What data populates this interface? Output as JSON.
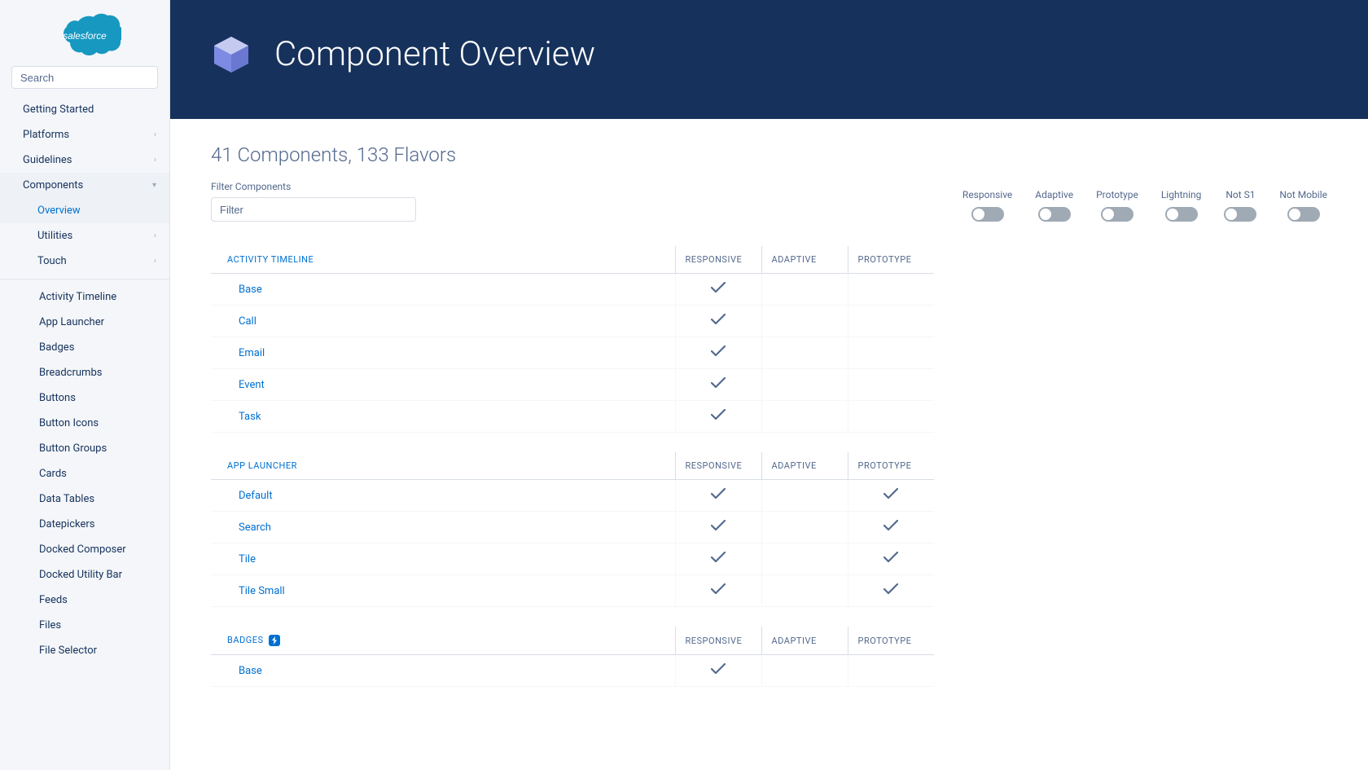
{
  "sidebar": {
    "search_placeholder": "Search",
    "top_nav": [
      {
        "label": "Getting Started",
        "expandable": false
      },
      {
        "label": "Platforms",
        "expandable": true
      },
      {
        "label": "Guidelines",
        "expandable": true
      },
      {
        "label": "Components",
        "expandable": true,
        "open": true
      }
    ],
    "components_sub": [
      {
        "label": "Overview",
        "selected": true,
        "expandable": false
      },
      {
        "label": "Utilities",
        "expandable": true
      },
      {
        "label": "Touch",
        "expandable": true
      }
    ],
    "component_list": [
      "Activity Timeline",
      "App Launcher",
      "Badges",
      "Breadcrumbs",
      "Buttons",
      "Button Icons",
      "Button Groups",
      "Cards",
      "Data Tables",
      "Datepickers",
      "Docked Composer",
      "Docked Utility Bar",
      "Feeds",
      "Files",
      "File Selector"
    ]
  },
  "hero": {
    "title": "Component Overview"
  },
  "summary": "41 Components, 133 Flavors",
  "filter": {
    "label": "Filter Components",
    "placeholder": "Filter"
  },
  "toggle_labels": [
    "Responsive",
    "Adaptive",
    "Prototype",
    "Lightning",
    "Not S1",
    "Not Mobile"
  ],
  "table_headers": [
    "RESPONSIVE",
    "ADAPTIVE",
    "PROTOTYPE"
  ],
  "groups": [
    {
      "name": "ACTIVITY TIMELINE",
      "lightning": false,
      "rows": [
        {
          "name": "Base",
          "responsive": true,
          "adaptive": false,
          "prototype": false
        },
        {
          "name": "Call",
          "responsive": true,
          "adaptive": false,
          "prototype": false
        },
        {
          "name": "Email",
          "responsive": true,
          "adaptive": false,
          "prototype": false
        },
        {
          "name": "Event",
          "responsive": true,
          "adaptive": false,
          "prototype": false
        },
        {
          "name": "Task",
          "responsive": true,
          "adaptive": false,
          "prototype": false
        }
      ]
    },
    {
      "name": "APP LAUNCHER",
      "lightning": false,
      "rows": [
        {
          "name": "Default",
          "responsive": true,
          "adaptive": false,
          "prototype": true
        },
        {
          "name": "Search",
          "responsive": true,
          "adaptive": false,
          "prototype": true
        },
        {
          "name": "Tile",
          "responsive": true,
          "adaptive": false,
          "prototype": true
        },
        {
          "name": "Tile Small",
          "responsive": true,
          "adaptive": false,
          "prototype": true
        }
      ]
    },
    {
      "name": "BADGES",
      "lightning": true,
      "rows": [
        {
          "name": "Base",
          "responsive": true,
          "adaptive": false,
          "prototype": false
        }
      ]
    }
  ]
}
